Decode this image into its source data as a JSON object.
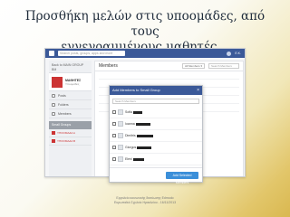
{
  "slide": {
    "title_line1": "Προσθήκη μελών στις υποομάδες, από τους",
    "title_line2": "εγγεγραμμένους μαθητές…",
    "footer_line1": "Εργαλείο κοινωνικής δικτύωσης Edmodo",
    "footer_line2": "Ευρωπαϊκό Σχολείο Ηρακλείου - 16/11/2013"
  },
  "app": {
    "search_placeholder": "Search posts, groups, apps and more",
    "user_label": "Ε.Κ.",
    "colors": {
      "brand": "#3b5998",
      "accent_button": "#3b8fd9",
      "group_red": "#cc3333"
    }
  },
  "sidebar": {
    "back_label": "Back to MAIN GROUP",
    "back_sub": "ΒΜ",
    "group_name": "ΜΑΘΗΤΕΣ",
    "group_sub": "Υποομάδες",
    "items": [
      {
        "label": "Posts",
        "icon": "list-icon"
      },
      {
        "label": "Folders",
        "icon": "folder-icon"
      },
      {
        "label": "Members",
        "icon": "people-icon"
      }
    ],
    "small_groups_label": "Small Groups",
    "small_groups": [
      "ΥΠΟΟΜΑΔΑ Α",
      "ΥΠΟΟΜΑΔΑ Β"
    ]
  },
  "members_panel": {
    "title": "Members",
    "filter_label": "All Members ▾",
    "search_placeholder": "Search Members"
  },
  "modal": {
    "title": "Add Members to Small Group",
    "close": "×",
    "search_placeholder": "Search Members",
    "members": [
      {
        "name": "Sofia"
      },
      {
        "name": "Ioanna"
      },
      {
        "name": "Dimitris"
      },
      {
        "name": "Giorgos"
      },
      {
        "name": "Eleni"
      }
    ],
    "add_button": "Add Selected Members"
  }
}
